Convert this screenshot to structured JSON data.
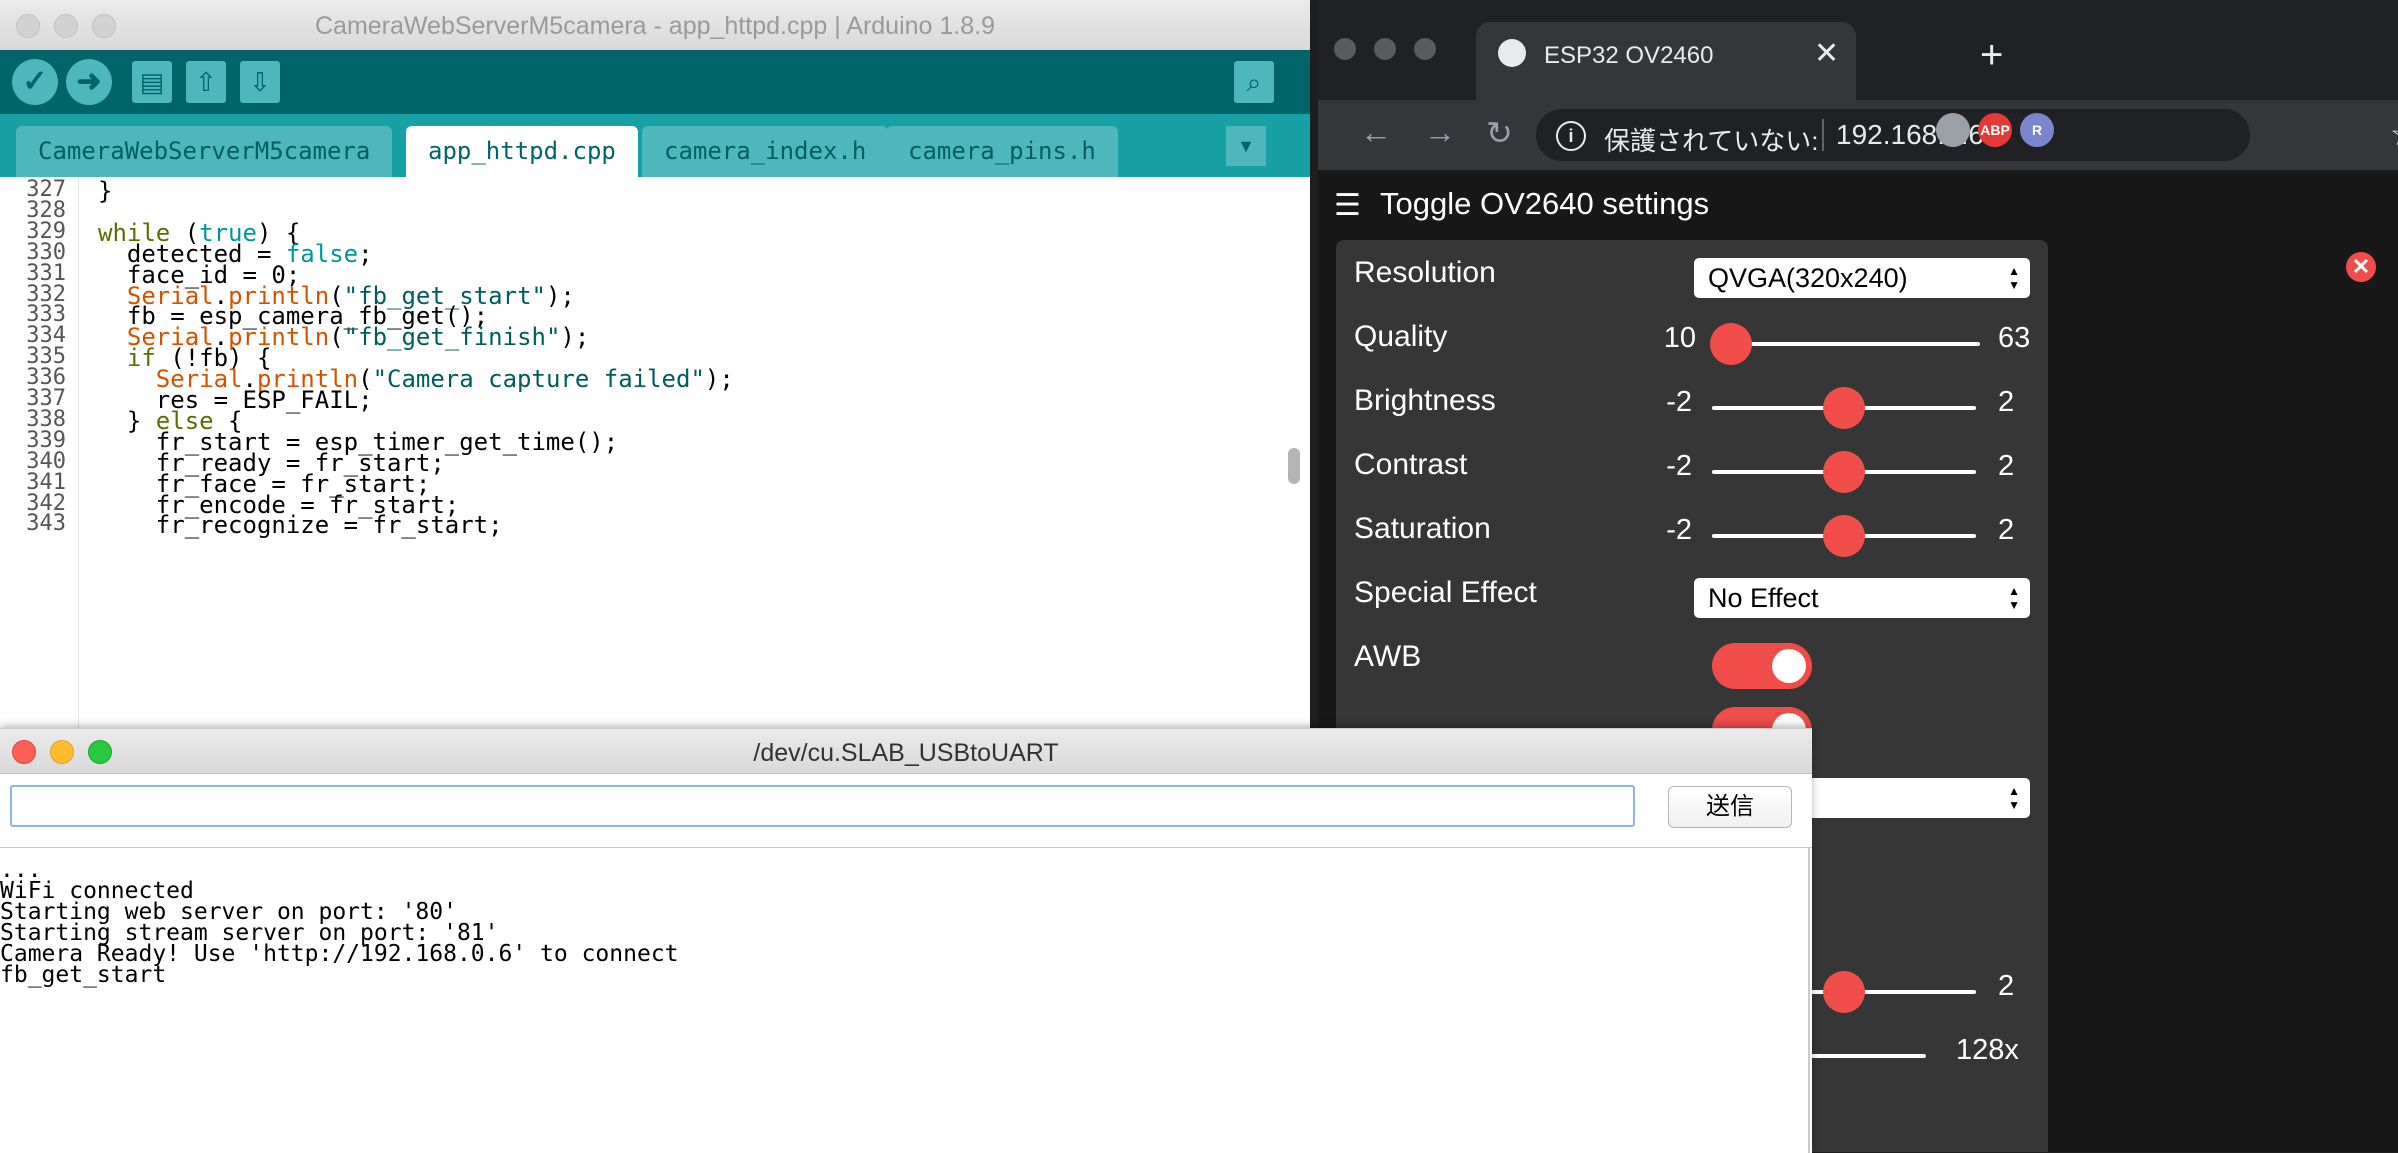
{
  "arduino": {
    "title": "CameraWebServerM5camera - app_httpd.cpp | Arduino 1.8.9",
    "toolbar": [
      "verify-icon",
      "upload-icon",
      "new-icon",
      "open-icon",
      "save-icon",
      "serial-monitor-icon"
    ],
    "tabs": [
      "CameraWebServerM5camera",
      "app_httpd.cpp",
      "camera_index.h",
      "camera_pins.h"
    ],
    "active_tab": "app_httpd.cpp",
    "line_numbers": [
      "327",
      "328",
      "329",
      "330",
      "331",
      "332",
      "333",
      "334",
      "335",
      "336",
      "337",
      "338",
      "339",
      "340",
      "341",
      "342",
      "343"
    ],
    "code": [
      [
        {
          "t": "}",
          "c": ""
        }
      ],
      [],
      [
        {
          "t": "while",
          "c": "kw"
        },
        {
          "t": " (",
          "c": ""
        },
        {
          "t": "true",
          "c": "lit"
        },
        {
          "t": ") {",
          "c": ""
        }
      ],
      [
        {
          "t": "  detected = ",
          "c": ""
        },
        {
          "t": "false",
          "c": "lit"
        },
        {
          "t": ";",
          "c": ""
        }
      ],
      [
        {
          "t": "  face_id = 0;",
          "c": ""
        }
      ],
      [
        {
          "t": "  ",
          "c": ""
        },
        {
          "t": "Serial",
          "c": "fn"
        },
        {
          "t": ".",
          "c": ""
        },
        {
          "t": "println",
          "c": "fn"
        },
        {
          "t": "(",
          "c": ""
        },
        {
          "t": "\"fb_get_start\"",
          "c": "str"
        },
        {
          "t": ");",
          "c": ""
        }
      ],
      [
        {
          "t": "  fb = esp_camera_fb_get();",
          "c": ""
        }
      ],
      [
        {
          "t": "  ",
          "c": ""
        },
        {
          "t": "Serial",
          "c": "fn"
        },
        {
          "t": ".",
          "c": ""
        },
        {
          "t": "println",
          "c": "fn"
        },
        {
          "t": "(",
          "c": ""
        },
        {
          "t": "\"fb_get_finish\"",
          "c": "str"
        },
        {
          "t": ");",
          "c": ""
        }
      ],
      [
        {
          "t": "  ",
          "c": ""
        },
        {
          "t": "if",
          "c": "kw"
        },
        {
          "t": " (!fb) {",
          "c": ""
        }
      ],
      [
        {
          "t": "    ",
          "c": ""
        },
        {
          "t": "Serial",
          "c": "fn"
        },
        {
          "t": ".",
          "c": ""
        },
        {
          "t": "println",
          "c": "fn"
        },
        {
          "t": "(",
          "c": ""
        },
        {
          "t": "\"Camera capture failed\"",
          "c": "str"
        },
        {
          "t": ");",
          "c": ""
        }
      ],
      [
        {
          "t": "    res = ESP_FAIL;",
          "c": ""
        }
      ],
      [
        {
          "t": "  } ",
          "c": ""
        },
        {
          "t": "else",
          "c": "kw"
        },
        {
          "t": " {",
          "c": ""
        }
      ],
      [
        {
          "t": "    fr_start = esp_timer_get_time();",
          "c": ""
        }
      ],
      [
        {
          "t": "    fr_ready = fr_start;",
          "c": ""
        }
      ],
      [
        {
          "t": "    fr_face = fr_start;",
          "c": ""
        }
      ],
      [
        {
          "t": "    fr_encode = fr_start;",
          "c": ""
        }
      ],
      [
        {
          "t": "    fr_recognize = fr_start;",
          "c": ""
        }
      ]
    ]
  },
  "serial": {
    "title": "/dev/cu.SLAB_USBtoUART",
    "input_value": "",
    "send_label": "送信",
    "output": [
      "...",
      "WiFi connected",
      "Starting web server on port: '80'",
      "Starting stream server on port: '81'",
      "Camera Ready! Use 'http://192.168.0.6' to connect",
      "fb_get_start"
    ]
  },
  "chrome": {
    "tab_title": "ESP32 OV2460",
    "security_label": "保護されていない:",
    "url": "192.168.0.6",
    "extensions": [
      {
        "name": "camera-icon",
        "color": "#9aa0a6",
        "text": ""
      },
      {
        "name": "adblock-icon",
        "color": "#e53935",
        "text": "ABP"
      },
      {
        "name": "extension-r-icon",
        "color": "#7986cb",
        "text": "R"
      }
    ]
  },
  "settings": {
    "toggle_label": "Toggle OV2640 settings",
    "resolution": {
      "label": "Resolution",
      "value": "QVGA(320x240)"
    },
    "quality": {
      "label": "Quality",
      "min": "10",
      "max": "63",
      "value": 10
    },
    "brightness": {
      "label": "Brightness",
      "min": "-2",
      "max": "2",
      "value": 0
    },
    "contrast": {
      "label": "Contrast",
      "min": "-2",
      "max": "2",
      "value": 0
    },
    "saturation": {
      "label": "Saturation",
      "min": "-2",
      "max": "2",
      "value": 0
    },
    "special_effect": {
      "label": "Special Effect",
      "value": "No Effect"
    },
    "awb": {
      "label": "AWB",
      "on": true
    },
    "partial_slider_max": "2",
    "partial_gain_max": "128x"
  }
}
